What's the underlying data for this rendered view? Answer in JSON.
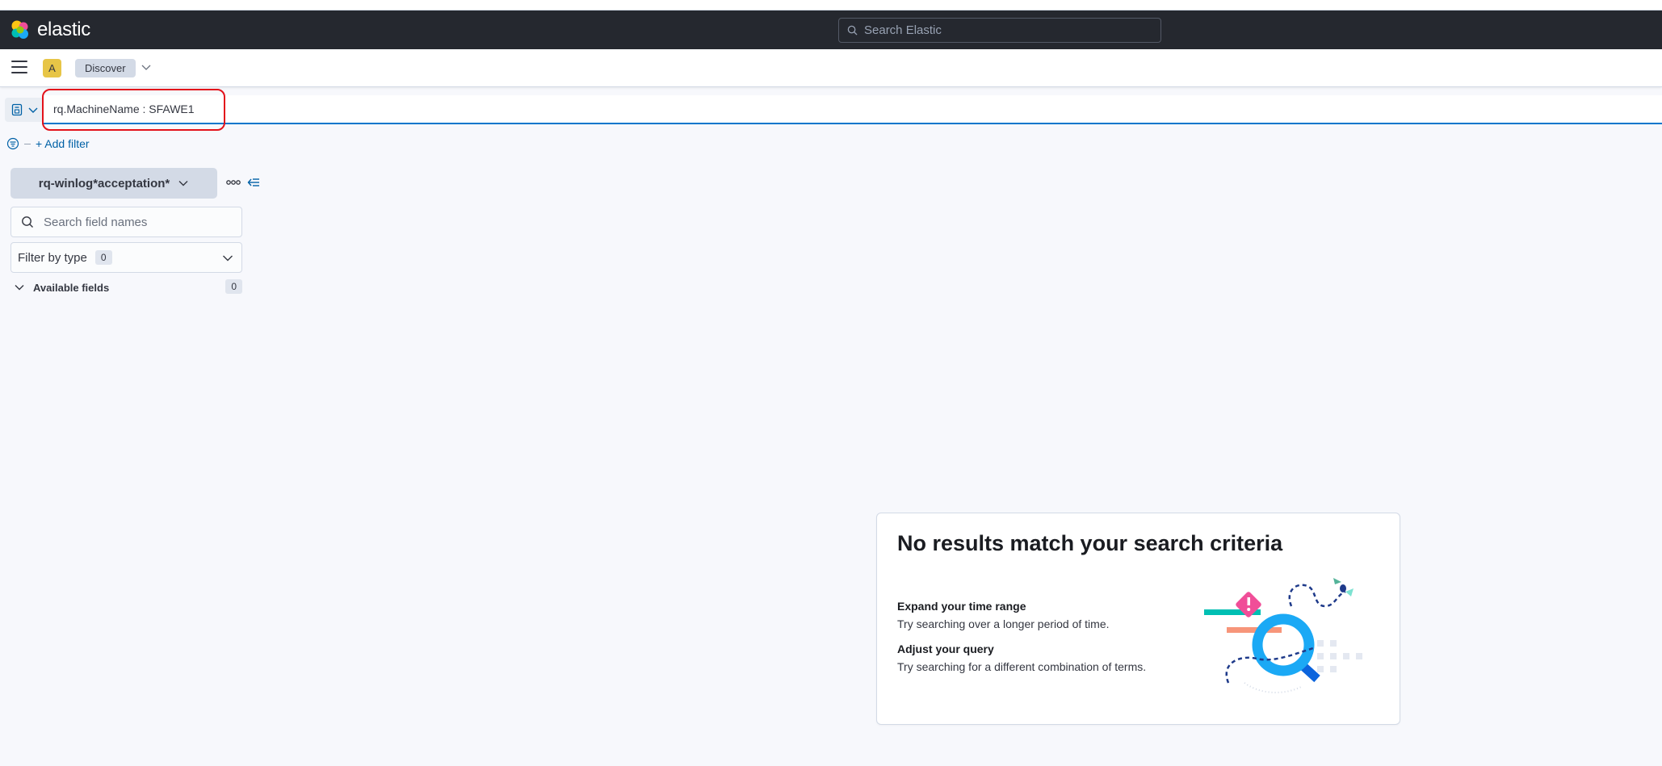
{
  "header": {
    "brand": "elastic",
    "search_placeholder": "Search Elastic"
  },
  "breadcrumbs": {
    "space_initial": "A",
    "current": "Discover"
  },
  "query": {
    "value": "rq.MachineName : SFAWE1"
  },
  "filters": {
    "add_filter_label": "+ Add filter"
  },
  "sidebar": {
    "index_pattern": "rq-winlog*acceptation*",
    "field_search_placeholder": "Search field names",
    "filter_by_type_label": "Filter by type",
    "filter_by_type_count": "0",
    "available_fields_label": "Available fields",
    "available_fields_count": "0"
  },
  "no_results": {
    "title": "No results match your search criteria",
    "tip1_title": "Expand your time range",
    "tip1_text": "Try searching over a longer period of time.",
    "tip2_title": "Adjust your query",
    "tip2_text": "Try searching for a different combination of terms."
  },
  "colors": {
    "header_bg": "#25282f",
    "accent": "#0077cc",
    "highlight": "#e3121b",
    "space_avatar": "#e7c547"
  },
  "icons": [
    "elastic-logo",
    "search-icon",
    "menu-icon",
    "chevron-down-icon",
    "saved-query-icon",
    "filter-icon",
    "more-icon",
    "collapse-icon"
  ]
}
